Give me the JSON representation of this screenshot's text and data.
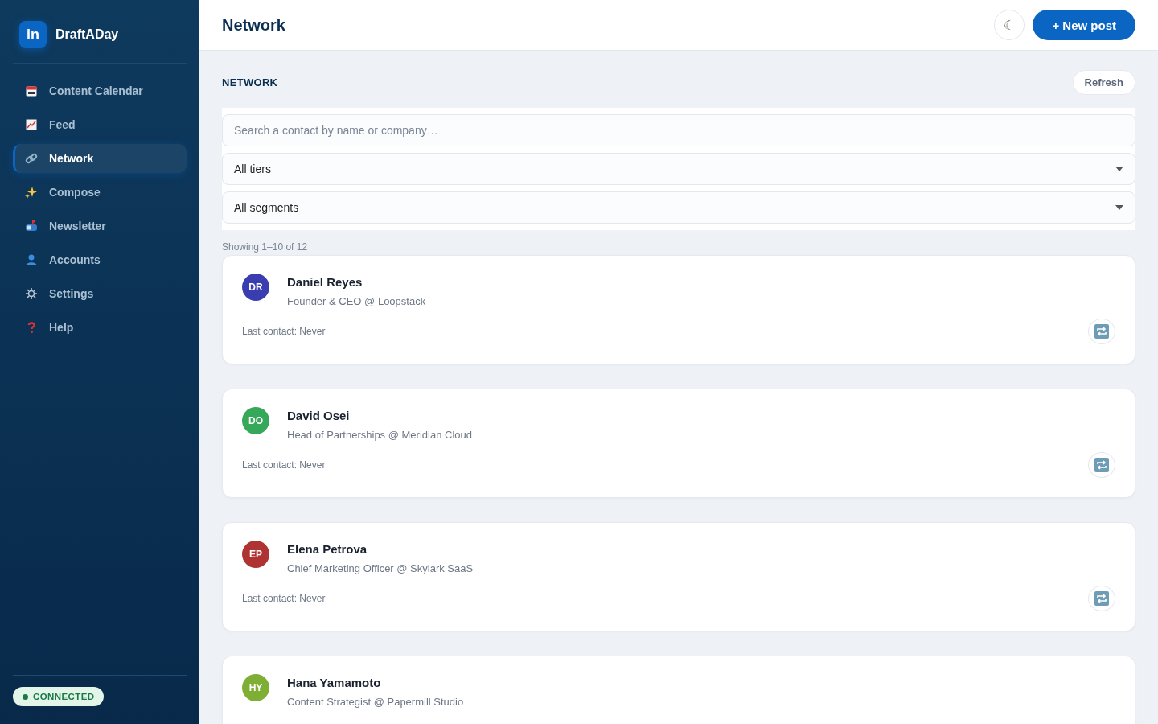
{
  "brand": {
    "logo": "in",
    "name": "DraftADay"
  },
  "nav": [
    {
      "label": "Content Calendar",
      "kind": "calendar",
      "selected": false
    },
    {
      "label": "Feed",
      "kind": "chart",
      "selected": false
    },
    {
      "label": "Network",
      "kind": "link",
      "selected": true
    },
    {
      "label": "Compose",
      "kind": "sparkle",
      "selected": false
    },
    {
      "label": "Newsletter",
      "kind": "mailbox",
      "selected": false
    },
    {
      "label": "Accounts",
      "kind": "person",
      "selected": false
    },
    {
      "label": "Settings",
      "kind": "gear",
      "selected": false
    },
    {
      "label": "Help",
      "kind": "question",
      "selected": false
    }
  ],
  "status": {
    "label": "CONNECTED",
    "color": "#1a7a47"
  },
  "header": {
    "title": "Network",
    "theme_icon": "☾",
    "new_post": "+ New post"
  },
  "section": {
    "title": "NETWORK",
    "refresh": "Refresh"
  },
  "filters": {
    "search_placeholder": "Search a contact by name or company…",
    "tier": "All tiers",
    "segment": "All segments"
  },
  "showing": "Showing 1–10 of 12",
  "contacts": [
    {
      "initials": "DR",
      "color": "#3a3db0",
      "name": "Daniel Reyes",
      "title": "Founder & CEO @ Loopstack",
      "last_contact": "Last contact: Never"
    },
    {
      "initials": "DO",
      "color": "#35a85a",
      "name": "David Osei",
      "title": "Head of Partnerships @ Meridian Cloud",
      "last_contact": "Last contact: Never"
    },
    {
      "initials": "EP",
      "color": "#b03333",
      "name": "Elena Petrova",
      "title": "Chief Marketing Officer @ Skylark SaaS",
      "last_contact": "Last contact: Never"
    },
    {
      "initials": "HY",
      "color": "#7fae35",
      "name": "Hana Yamamoto",
      "title": "Content Strategist @ Papermill Studio"
    }
  ]
}
